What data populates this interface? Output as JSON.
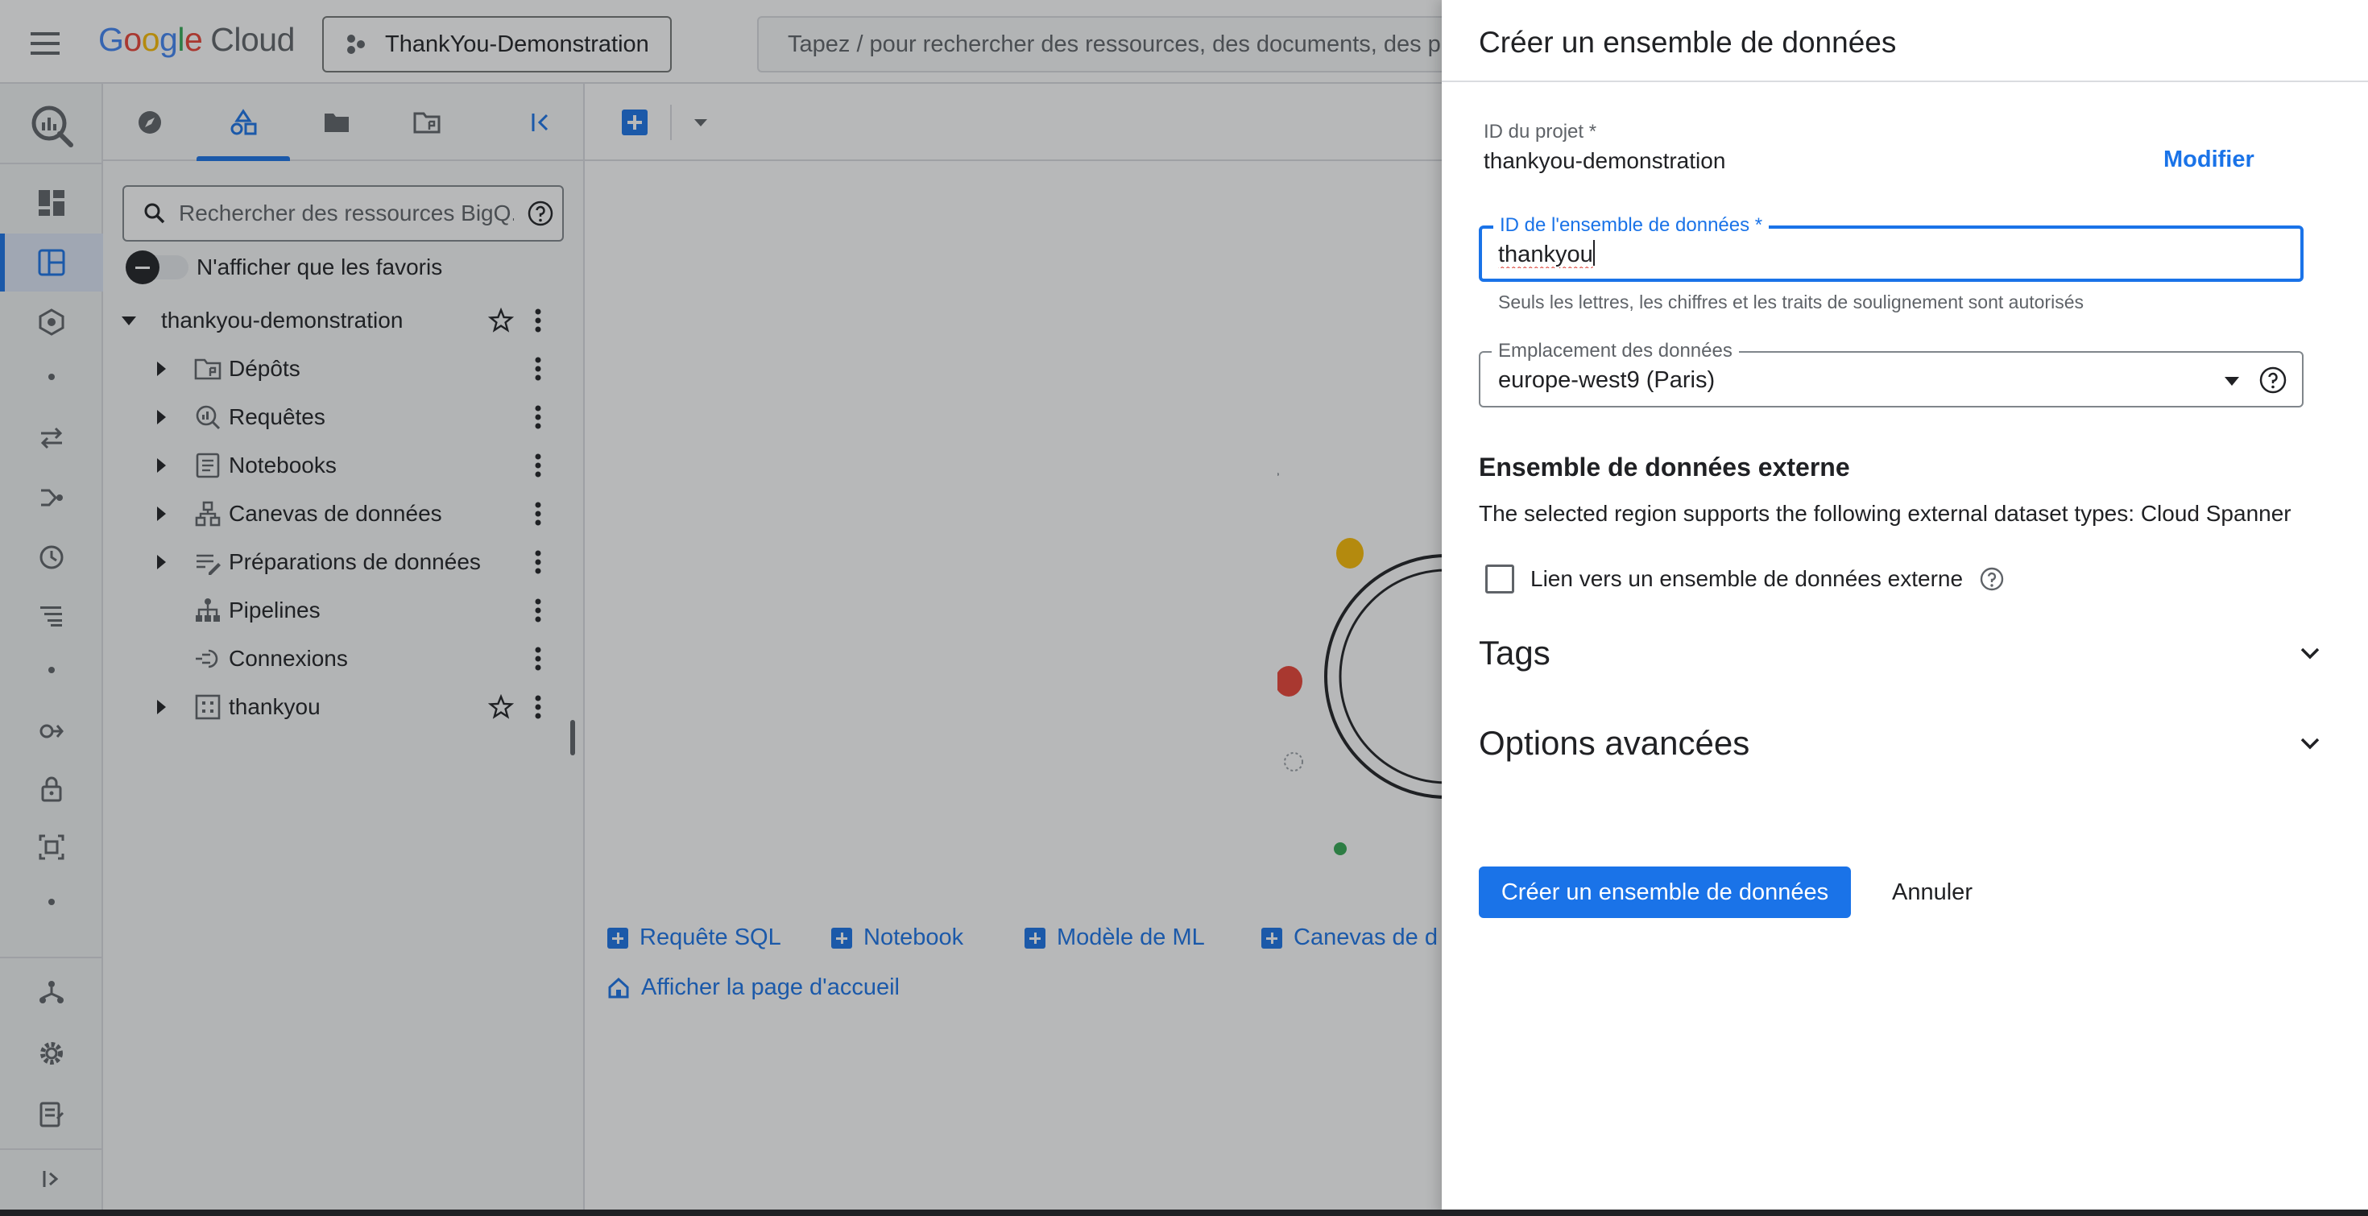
{
  "header": {
    "logo_word": "Google",
    "logo_suffix": "Cloud",
    "project_name": "ThankYou-Demonstration",
    "search_placeholder": "Tapez / pour rechercher des ressources, des documents, des prod"
  },
  "explorer": {
    "search_placeholder": "Rechercher des ressources BigQ...",
    "favorites_label": "N'afficher que les favoris",
    "project": "thankyou-demonstration",
    "items": [
      {
        "label": "Dépôts",
        "expandable": true,
        "icon": "repository-icon"
      },
      {
        "label": "Requêtes",
        "expandable": true,
        "icon": "query-icon"
      },
      {
        "label": "Notebooks",
        "expandable": true,
        "icon": "notebook-icon"
      },
      {
        "label": "Canevas de données",
        "expandable": true,
        "icon": "canvas-icon"
      },
      {
        "label": "Préparations de données",
        "expandable": true,
        "icon": "data-prep-icon"
      },
      {
        "label": "Pipelines",
        "expandable": false,
        "icon": "pipeline-icon"
      },
      {
        "label": "Connexions",
        "expandable": false,
        "icon": "connection-icon"
      },
      {
        "label": "thankyou",
        "expandable": true,
        "icon": "dataset-icon"
      }
    ]
  },
  "main": {
    "quick_links": [
      "Requête SQL",
      "Notebook",
      "Modèle de ML",
      "Canevas de d"
    ],
    "home_link": "Afficher la page d'accueil"
  },
  "dialog": {
    "title": "Créer un ensemble de données",
    "project_id_label": "ID du projet *",
    "project_id_value": "thankyou-demonstration",
    "edit_label": "Modifier",
    "dataset_id_label": "ID de l'ensemble de données *",
    "dataset_id_value": "thankyou",
    "dataset_id_hint": "Seuls les lettres, les chiffres et les traits de soulignement sont autorisés",
    "location_label": "Emplacement des données",
    "location_value": "europe-west9 (Paris)",
    "external_title": "Ensemble de données externe",
    "external_desc": "The selected region supports the following external dataset types: Cloud Spanner",
    "external_checkbox_label": "Lien vers un ensemble de données externe",
    "external_checkbox_checked": false,
    "tags_label": "Tags",
    "advanced_label": "Options avancées",
    "create_label": "Créer un ensemble de données",
    "cancel_label": "Annuler"
  },
  "colors": {
    "accent": "#1a73e8",
    "google_blue": "#4285f4",
    "google_red": "#ea4335",
    "google_yellow": "#fbbc04",
    "google_green": "#34a853",
    "text": "#202124",
    "muted": "#5f6368"
  }
}
